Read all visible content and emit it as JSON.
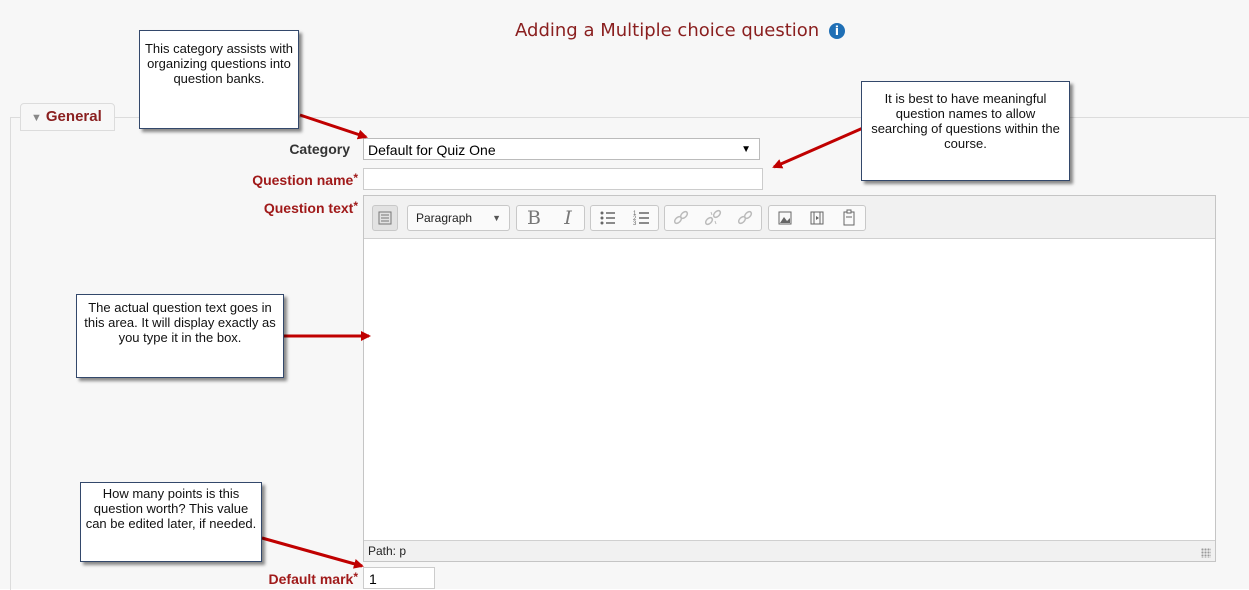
{
  "page": {
    "title": "Adding a Multiple choice question",
    "info_icon": "info-icon"
  },
  "section": {
    "legend": "General",
    "legend_icon": "caret-down-icon"
  },
  "form": {
    "category_label": "Category",
    "category_value": "Default for Quiz One",
    "question_name_label": "Question name",
    "question_name_value": "",
    "question_text_label": "Question text",
    "default_mark_label": "Default mark",
    "default_mark_value": "1",
    "required_marker": "*"
  },
  "editor": {
    "paragraph_label": "Paragraph",
    "bold": "B",
    "italic": "I",
    "path_text": "Path: p",
    "toolbar_icons": [
      "toolbar-toggle-icon",
      "bold-icon",
      "italic-icon",
      "bullet-list-icon",
      "numbered-list-icon",
      "link-icon",
      "unlink-icon",
      "anchor-link-icon",
      "image-icon",
      "media-icon",
      "paste-icon"
    ]
  },
  "callouts": {
    "category": "This category assists with organizing questions into question banks.",
    "name": "It is best to have meaningful question names to allow searching of questions within the course.",
    "text": "The actual question text goes in this area. It will display exactly as you type it in the box.",
    "mark": "How many points is this question worth?  This value can be edited later, if needed."
  },
  "colors": {
    "title": "#8a1f1f",
    "required_label": "#a01a1a",
    "arrow": "#c00000",
    "info_icon": "#1f6fb5"
  }
}
